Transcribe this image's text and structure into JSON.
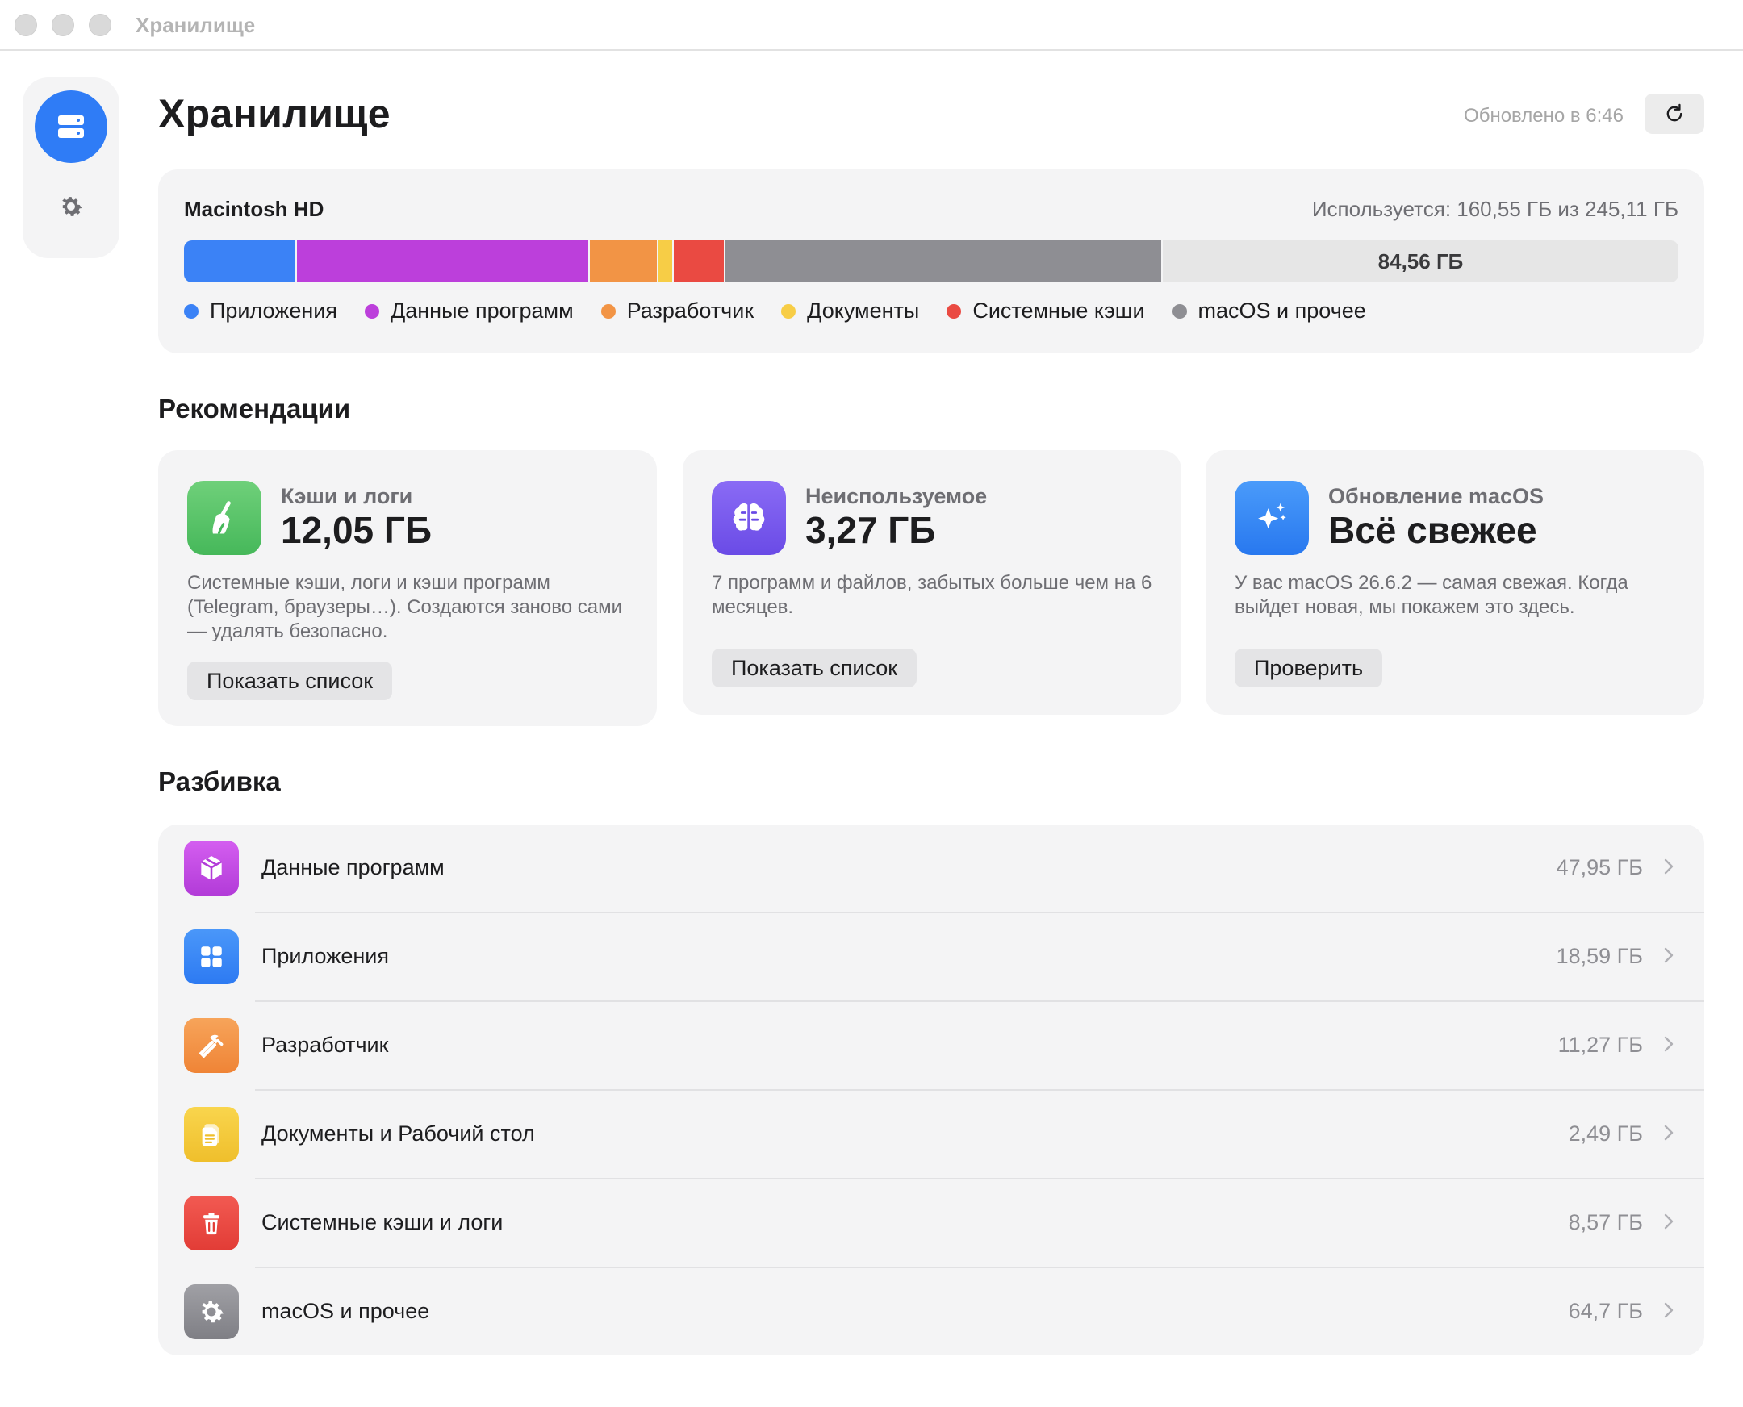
{
  "window": {
    "title": "Хранилище"
  },
  "sidebar": {
    "items": [
      {
        "icon": "storage-icon",
        "active": true
      },
      {
        "icon": "gear-icon",
        "active": false
      }
    ]
  },
  "header": {
    "title": "Хранилище",
    "updated": "Обновлено в 6:46",
    "refresh_icon": "refresh-icon"
  },
  "disk": {
    "name": "Macintosh HD",
    "used_text": "Используется: 160,55 ГБ из 245,11 ГБ",
    "free_label": "84,56 ГБ",
    "segments": [
      {
        "key": "apps",
        "value_gb": 18.59,
        "color": "#3b82f6"
      },
      {
        "key": "appdata",
        "value_gb": 47.95,
        "color": "#bc3fdb"
      },
      {
        "key": "dev",
        "value_gb": 11.27,
        "color": "#f29445"
      },
      {
        "key": "docs",
        "value_gb": 2.49,
        "color": "#f7cd46"
      },
      {
        "key": "syscache",
        "value_gb": 8.57,
        "color": "#ea4a42"
      },
      {
        "key": "macos",
        "value_gb": 71.68,
        "color": "#8e8e93"
      }
    ],
    "legend": [
      {
        "label": "Приложения",
        "color": "#3b82f6"
      },
      {
        "label": "Данные программ",
        "color": "#bc3fdb"
      },
      {
        "label": "Разработчик",
        "color": "#f29445"
      },
      {
        "label": "Документы",
        "color": "#f7cd46"
      },
      {
        "label": "Системные кэши",
        "color": "#ea4a42"
      },
      {
        "label": "macOS и прочее",
        "color": "#8e8e93"
      }
    ]
  },
  "recommendations": {
    "title": "Рекомендации",
    "cards": [
      {
        "icon": "broom-icon",
        "label": "Кэши и логи",
        "value": "12,05 ГБ",
        "description": "Системные кэши, логи и кэши программ (Telegram, браузеры…). Создаются заново сами — удалять безопасно.",
        "button": "Показать список"
      },
      {
        "icon": "brain-icon",
        "label": "Неиспользуемое",
        "value": "3,27 ГБ",
        "description": "7 программ и файлов, забытых больше чем на 6 месяцев.",
        "button": "Показать список"
      },
      {
        "icon": "sparkles-icon",
        "label": "Обновление macOS",
        "value": "Всё свежее",
        "description": "У вас macOS 26.6.2 — самая свежая. Когда выйдет новая, мы покажем это здесь.",
        "button": "Проверить"
      }
    ]
  },
  "breakdown": {
    "title": "Разбивка",
    "rows": [
      {
        "icon": "package-icon",
        "label": "Данные программ",
        "size": "47,95 ГБ"
      },
      {
        "icon": "apps-grid-icon",
        "label": "Приложения",
        "size": "18,59 ГБ"
      },
      {
        "icon": "hammer-icon",
        "label": "Разработчик",
        "size": "11,27 ГБ"
      },
      {
        "icon": "document-icon",
        "label": "Документы и Рабочий стол",
        "size": "2,49 ГБ"
      },
      {
        "icon": "trash-icon",
        "label": "Системные кэши и логи",
        "size": "8,57 ГБ"
      },
      {
        "icon": "gear-icon",
        "label": "macOS и прочее",
        "size": "64,7 ГБ"
      }
    ]
  },
  "colors": {
    "accent": "#2f7cf6",
    "apps": "#3b82f6",
    "appdata": "#bc3fdb",
    "dev": "#f29445",
    "docs": "#f7cd46",
    "syscache": "#ea4a42",
    "macos": "#8e8e93"
  }
}
